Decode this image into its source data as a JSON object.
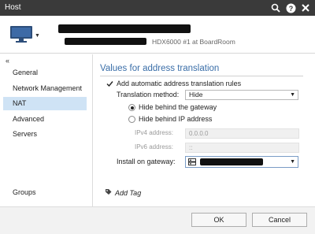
{
  "window": {
    "title": "Host"
  },
  "header": {
    "subtitle": "HDX6000 #1 at BoardRoom"
  },
  "sidebar": {
    "items": [
      {
        "label": "General"
      },
      {
        "label": "Network Management"
      },
      {
        "label": "NAT"
      },
      {
        "label": "Advanced"
      },
      {
        "label": "Servers"
      },
      {
        "label": "Groups"
      }
    ]
  },
  "main": {
    "section_title": "Values for address translation",
    "auto_rules_label": "Add automatic address translation rules",
    "translation_method_label": "Translation method:",
    "translation_method_value": "Hide",
    "hide_gateway_label": "Hide behind the gateway",
    "hide_ip_label": "Hide behind IP address",
    "ipv4_label": "IPv4 address:",
    "ipv4_value": "0.0.0.0",
    "ipv6_label": "IPv6 address:",
    "ipv6_value": "::",
    "install_label": "Install on gateway:",
    "add_tag_label": "Add Tag"
  },
  "footer": {
    "ok_label": "OK",
    "cancel_label": "Cancel"
  },
  "colors": {
    "accent": "#3a6ea8",
    "active_nav": "#cfe3f5",
    "titlebar": "#3a3a3a"
  }
}
